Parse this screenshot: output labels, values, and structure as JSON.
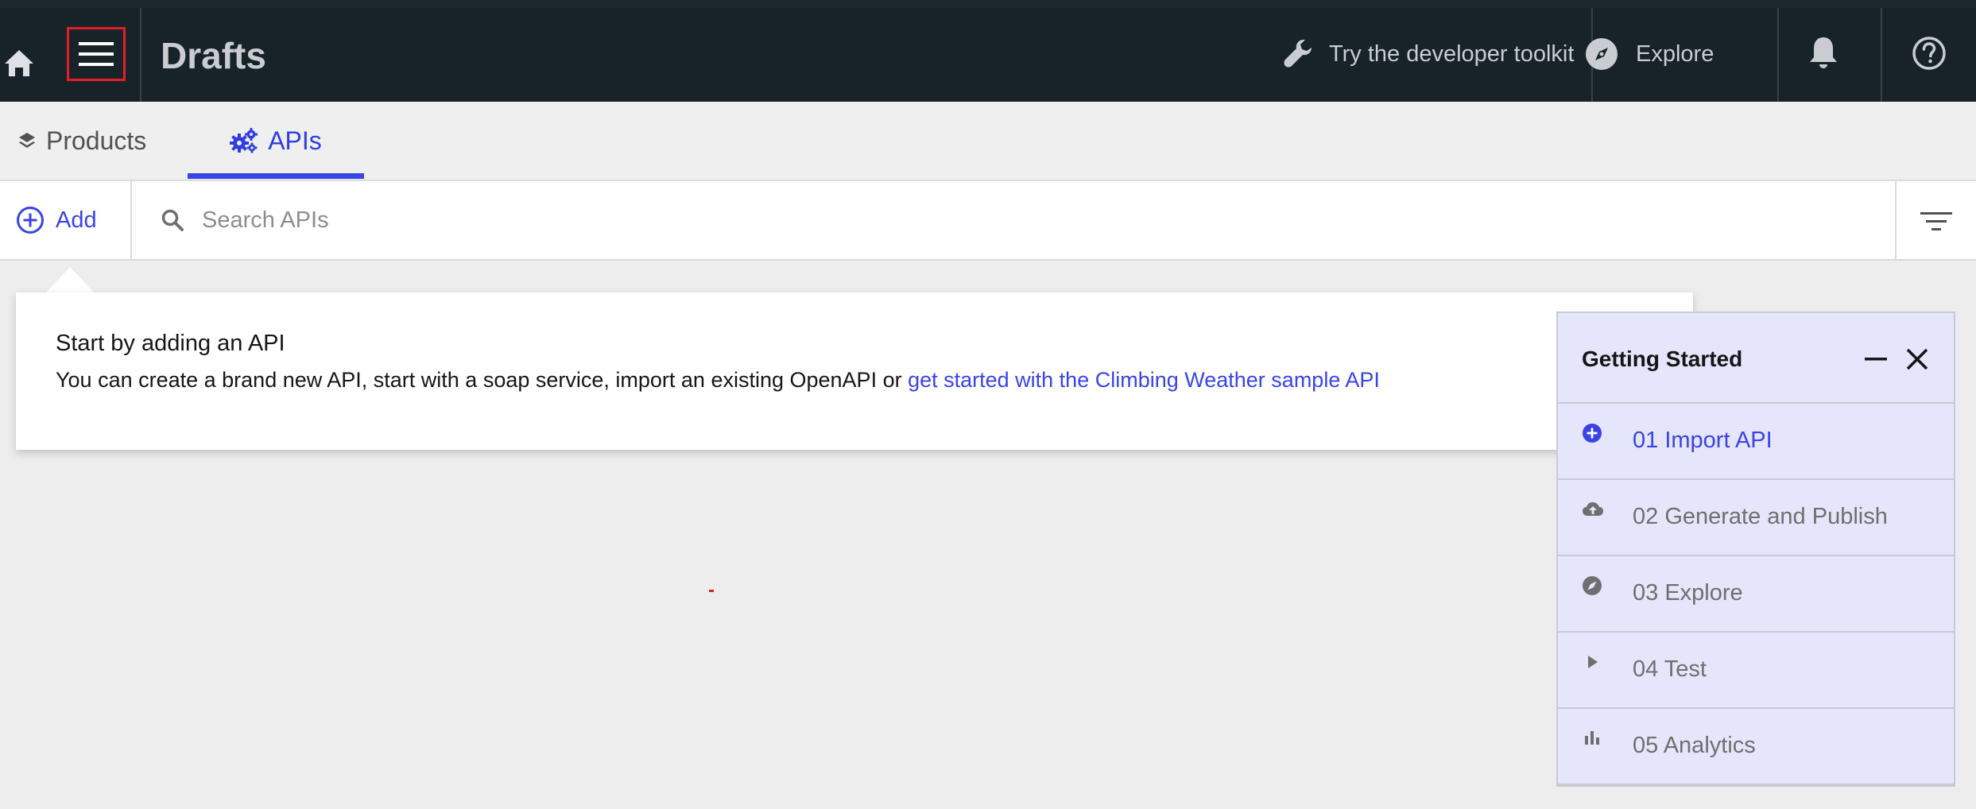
{
  "colors": {
    "topbar_bg": "#172329",
    "accent": "#3944e6",
    "page_bg": "#ededed",
    "panel_bg": "#e5e6fb",
    "highlight_outline": "#e21f26"
  },
  "header": {
    "home_icon": "home-icon",
    "menu_icon": "hamburger-menu-icon",
    "title": "Drafts",
    "toolkit_icon": "wrench-icon",
    "toolkit_label": "Try the developer toolkit",
    "explore_icon": "compass-icon",
    "explore_label": "Explore",
    "notifications_icon": "bell-icon",
    "help_icon": "help-icon"
  },
  "tabs": [
    {
      "label": "Products",
      "icon": "layers-icon",
      "active": false
    },
    {
      "label": "APIs",
      "icon": "gears-icon",
      "active": true
    }
  ],
  "toolbar": {
    "add_label": "Add",
    "add_icon": "add-circle-icon",
    "search_icon": "search-icon",
    "search_placeholder": "Search APIs",
    "search_value": "",
    "filter_icon": "filter-icon"
  },
  "info_card": {
    "title": "Start by adding an API",
    "text": "You can create a brand new API, start with a soap service, import an existing OpenAPI or ",
    "link_text": "get started with the Climbing Weather sample API"
  },
  "getting_started": {
    "title": "Getting Started",
    "minimize_icon": "minimize-icon",
    "close_icon": "close-icon",
    "items": [
      {
        "label": "01 Import API",
        "icon": "add-filled-icon",
        "active": true
      },
      {
        "label": "02 Generate and Publish",
        "icon": "cloud-upload-icon",
        "active": false
      },
      {
        "label": "03 Explore",
        "icon": "compass-icon",
        "active": false
      },
      {
        "label": "04 Test",
        "icon": "play-icon",
        "active": false
      },
      {
        "label": "05 Analytics",
        "icon": "analytics-icon",
        "active": false
      }
    ]
  }
}
